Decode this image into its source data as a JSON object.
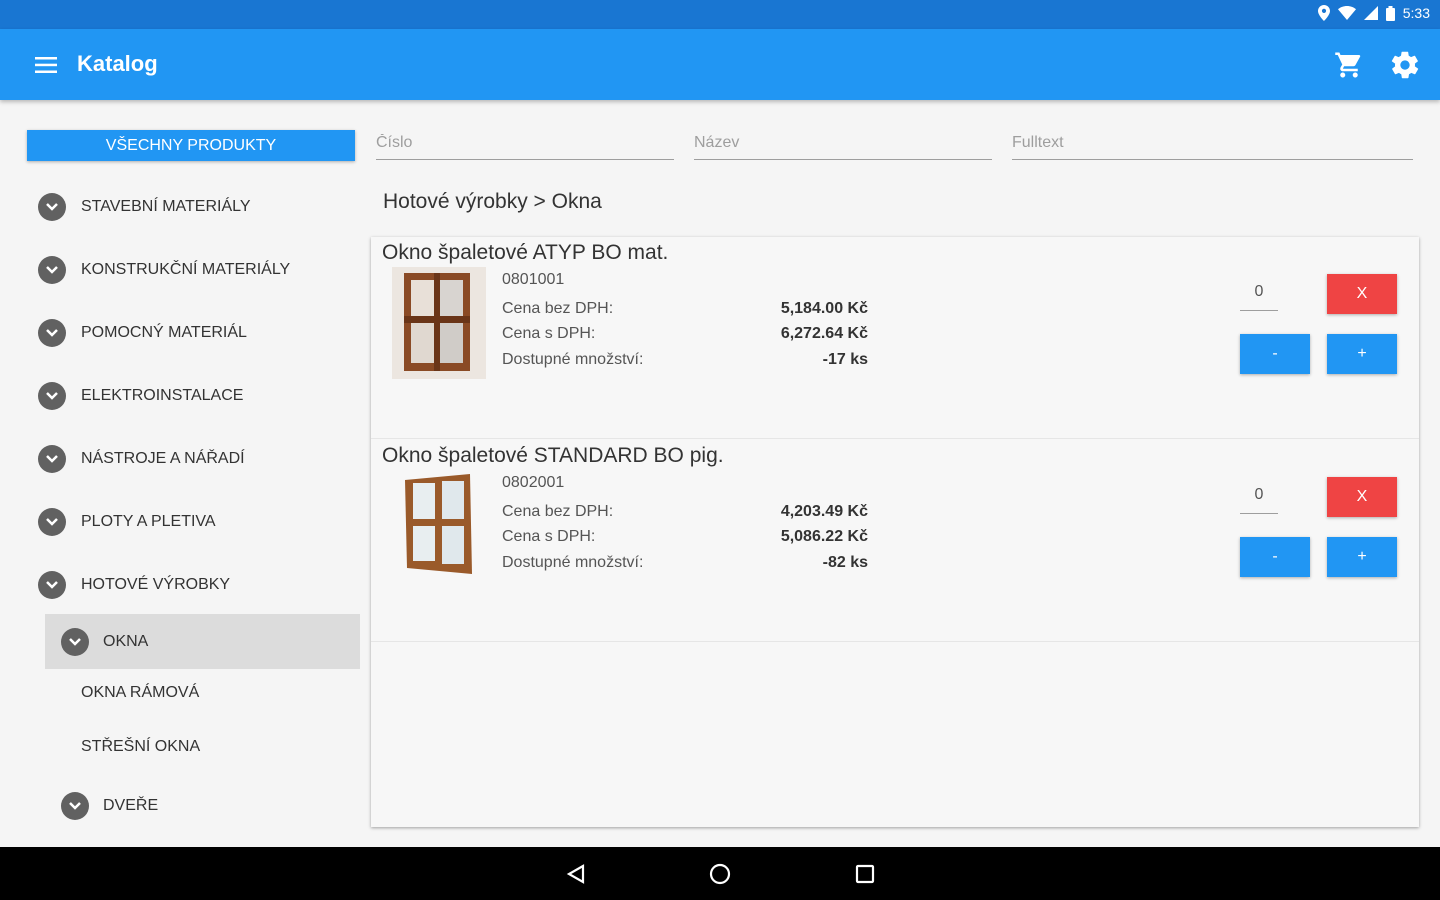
{
  "status_bar": {
    "time": "5:33",
    "icons": [
      "location-icon",
      "wifi-icon",
      "signal-icon",
      "battery-icon"
    ]
  },
  "toolbar": {
    "title": "Katalog",
    "menu_icon": "menu-icon",
    "cart_icon": "cart-icon",
    "settings_icon": "gear-icon"
  },
  "sidebar": {
    "all_products_label": "VŠECHNY PRODUKTY",
    "categories": [
      "STAVEBNÍ MATERIÁLY",
      "KONSTRUKČNÍ MATERIÁLY",
      "POMOCNÝ MATERIÁL",
      "ELEKTROINSTALACE",
      "NÁSTROJE A NÁŘADÍ",
      "PLOTY A PLETIVA",
      "HOTOVÉ VÝROBKY"
    ],
    "subcategories": [
      "OKNA",
      "OKNA RÁMOVÁ",
      "STŘEŠNÍ OKNA",
      "DVEŘE"
    ],
    "selected": "OKNA"
  },
  "filters": {
    "number_placeholder": "Číslo",
    "name_placeholder": "Název",
    "fulltext_placeholder": "Fulltext"
  },
  "breadcrumb": "Hotové výrobky > Okna",
  "products": [
    {
      "name": "Okno špaletové ATYP BO mat.",
      "code": "0801001",
      "price_without_vat_label": "Cena bez DPH:",
      "price_without_vat": "5,184.00 Kč",
      "price_with_vat_label": "Cena s DPH:",
      "price_with_vat": "6,272.64 Kč",
      "available_label": "Dostupné množství:",
      "available": "-17 ks",
      "quantity": "0",
      "remove_label": "X",
      "minus_label": "-",
      "plus_label": "+"
    },
    {
      "name": "Okno špaletové STANDARD BO pig.",
      "code": "0802001",
      "price_without_vat_label": "Cena bez DPH:",
      "price_without_vat": "4,203.49 Kč",
      "price_with_vat_label": "Cena s DPH:",
      "price_with_vat": "5,086.22 Kč",
      "available_label": "Dostupné množství:",
      "available": "-82 ks",
      "quantity": "0",
      "remove_label": "X",
      "minus_label": "-",
      "plus_label": "+"
    }
  ],
  "colors": {
    "primary": "#2196f3",
    "primary_dark": "#1976d2",
    "danger": "#ef4444"
  }
}
